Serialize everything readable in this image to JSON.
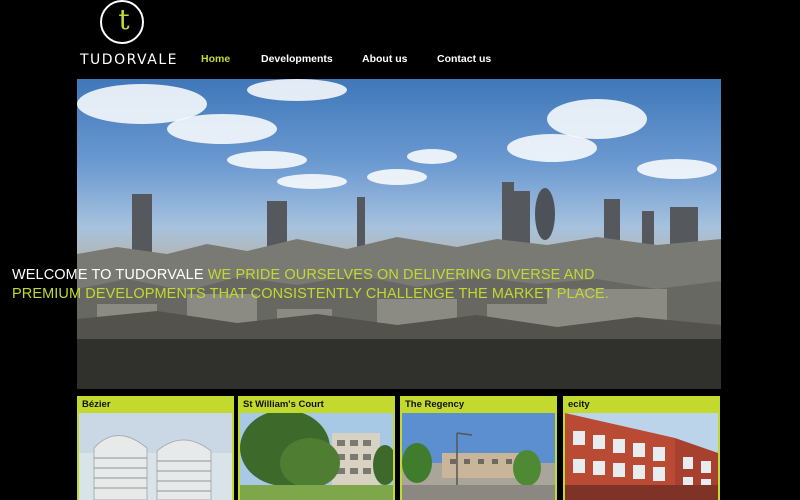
{
  "brand": {
    "name": "TUDORVALE",
    "monogram": "t",
    "accent_color": "#c4d92e"
  },
  "nav": {
    "items": [
      {
        "label": "Home",
        "active": true
      },
      {
        "label": "Developments",
        "active": false
      },
      {
        "label": "About us",
        "active": false
      },
      {
        "label": "Contact us",
        "active": false
      }
    ]
  },
  "hero": {
    "caption_lead": "WELCOME TO TUDORVALE",
    "caption_rest": " WE PRIDE OURSELVES ON DELIVERING DIVERSE AND PREMIUM DEVELOPMENTS THAT CONSISTENTLY CHALLENGE THE MARKET PLACE."
  },
  "developments": [
    {
      "title": "Bézier"
    },
    {
      "title": "St William's Court"
    },
    {
      "title": "The Regency"
    },
    {
      "title": "ecity"
    }
  ]
}
